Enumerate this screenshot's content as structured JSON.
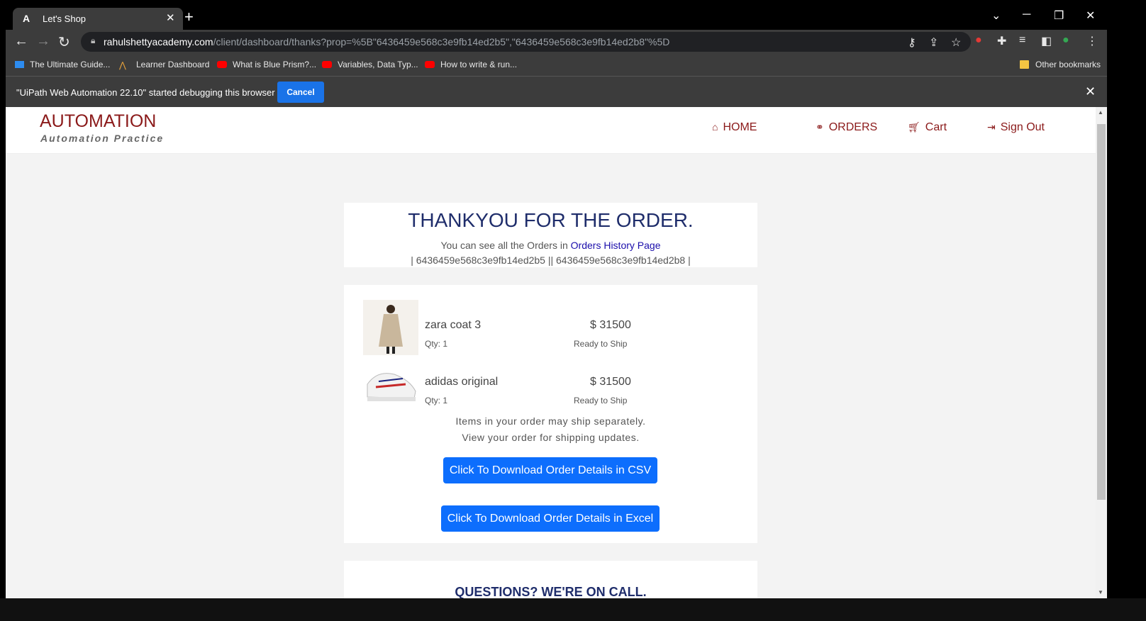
{
  "browser": {
    "tab_title": "Let's Shop",
    "tab_favicon": "A",
    "url_host": "rahulshettyacademy.com",
    "url_path": "/client/dashboard/thanks?prop=%5B\"6436459e568c3e9fb14ed2b5\",\"6436459e568c3e9fb14ed2b8\"%5D",
    "bookmarks": [
      {
        "label": "The Ultimate Guide..."
      },
      {
        "label": "Learner Dashboard"
      },
      {
        "label": "What is Blue Prism?..."
      },
      {
        "label": "Variables, Data Typ..."
      },
      {
        "label": "How to write & run..."
      }
    ],
    "other_bookmarks": "Other bookmarks",
    "debug_message": "\"UiPath Web Automation 22.10\" started debugging this browser",
    "debug_cancel": "Cancel"
  },
  "site": {
    "brand": "AUTOMATION",
    "brand_sub": "Automation Practice",
    "nav": {
      "home": "HOME",
      "orders": "ORDERS",
      "cart": "Cart",
      "signout": "Sign Out"
    }
  },
  "thanks": {
    "title": "THANKYOU FOR THE ORDER.",
    "orders_prefix": "You can see all the Orders in",
    "orders_link": "Orders History Page",
    "order_ids": "| 6436459e568c3e9fb14ed2b5 || 6436459e568c3e9fb14ed2b8 |"
  },
  "items": [
    {
      "name": "zara coat 3",
      "price": "$ 31500",
      "qty": "Qty: 1",
      "status": "Ready to Ship"
    },
    {
      "name": "adidas original",
      "price": "$ 31500",
      "qty": "Qty: 1",
      "status": "Ready to Ship"
    }
  ],
  "shipping_note_1": "Items in your order may ship separately.",
  "shipping_note_2": "View your order for shipping updates.",
  "download_csv": "Click To Download Order Details in CSV",
  "download_excel": "Click To Download Order Details in Excel",
  "questions_title": "QUESTIONS? WE'RE ON CALL."
}
